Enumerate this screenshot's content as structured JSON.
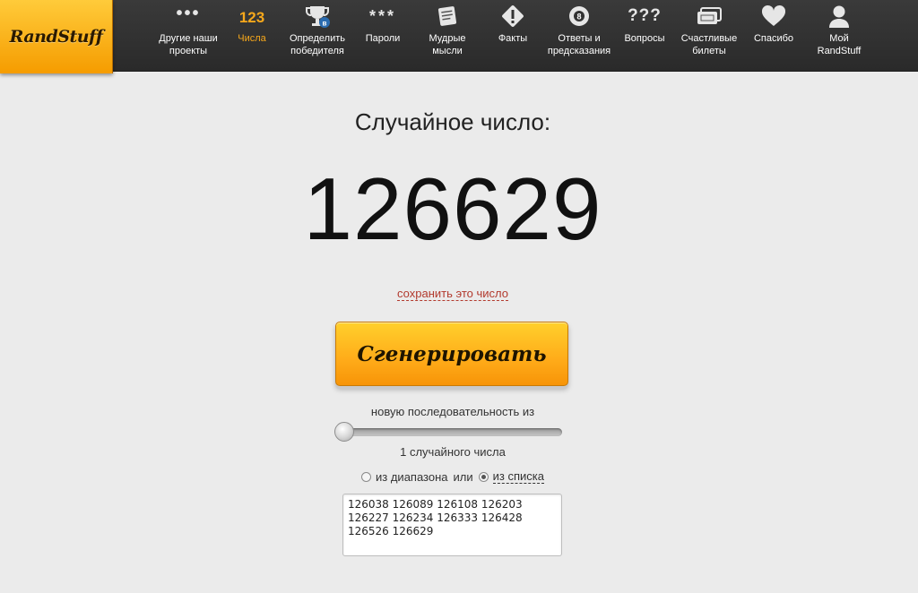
{
  "logo": "RandStuff",
  "nav": [
    {
      "label": "Другие наши\nпроекты",
      "icon": "dots-icon",
      "glyph": "•••"
    },
    {
      "label": "Числа",
      "icon": "numbers-icon",
      "glyph": "123"
    },
    {
      "label": "Определить\nпобедителя",
      "icon": "trophy-icon"
    },
    {
      "label": "Пароли",
      "icon": "asterisks-icon",
      "glyph": "***"
    },
    {
      "label": "Мудрые\nмысли",
      "icon": "scroll-icon"
    },
    {
      "label": "Факты",
      "icon": "exclamation-diamond-icon"
    },
    {
      "label": "Ответы и\nпредсказания",
      "icon": "eight-ball-icon"
    },
    {
      "label": "Вопросы",
      "icon": "question-marks-icon",
      "glyph": "???"
    },
    {
      "label": "Счастливые\nбилеты",
      "icon": "tickets-icon"
    },
    {
      "label": "Спасибо",
      "icon": "heart-icon"
    },
    {
      "label": "Мой\nRandStuff",
      "icon": "user-icon"
    }
  ],
  "active_nav": 1,
  "main": {
    "heading": "Случайное число:",
    "number": "126629",
    "save_link": "сохранить это число",
    "generate_button": "Сгенерировать",
    "sequence_label": "новую последовательность из",
    "count_label": "1 случайного числа",
    "mode_range": "из диапазона",
    "mode_or": "или",
    "mode_list": "из списка",
    "selected_mode": "list",
    "list_value": "126038 126089 126108 126203\n126227 126234 126333 126428\n126526 126629"
  },
  "colors": {
    "accent": "#f7a81b",
    "link": "#b23a2e"
  }
}
